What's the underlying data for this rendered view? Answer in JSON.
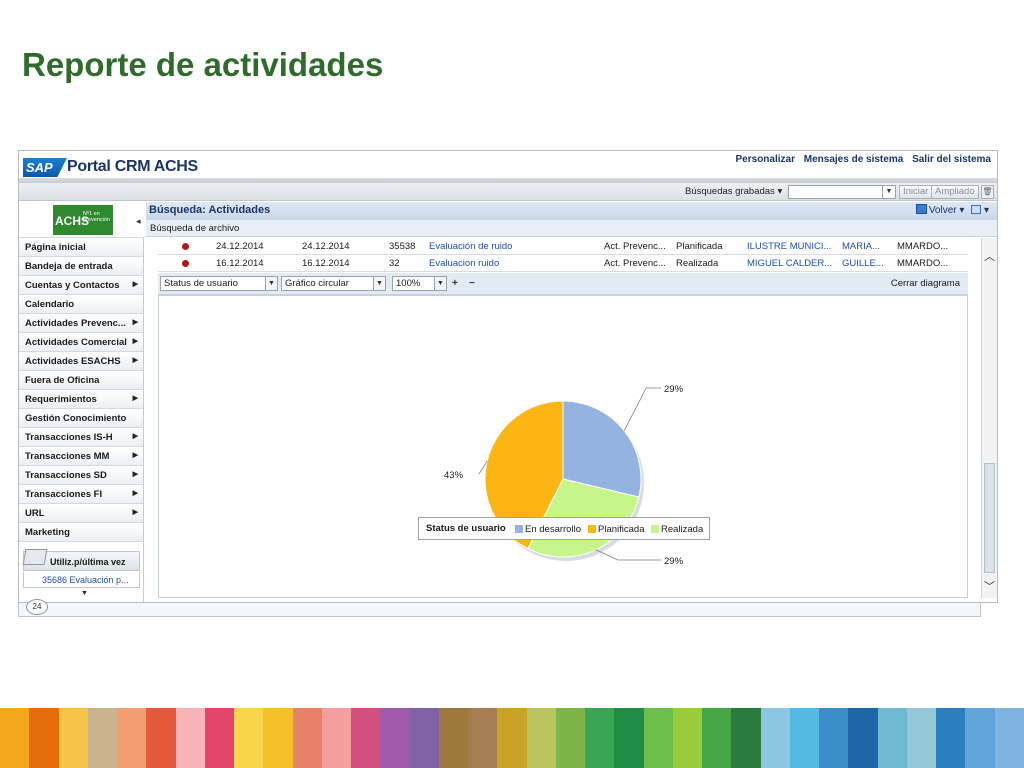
{
  "slide": {
    "title": "Reporte de actividades"
  },
  "portal": {
    "title": "Portal CRM ACHS",
    "logo_text": "SAP",
    "links": [
      "Personalizar",
      "Mensajes de sistema",
      "Salir del sistema"
    ]
  },
  "searchbar": {
    "saved_label": "Búsquedas grabadas",
    "input_value": "",
    "start_label": "Iniciar",
    "extended_label": "Ampliado"
  },
  "sidebar": {
    "logo_text": "ACHS",
    "logo_sub": "Nº1 en prevención",
    "items": [
      {
        "label": "Página inicial",
        "submenu": false
      },
      {
        "label": "Bandeja de entrada",
        "submenu": false
      },
      {
        "label": "Cuentas y Contactos",
        "submenu": true
      },
      {
        "label": "Calendario",
        "submenu": false
      },
      {
        "label": "Actividades Prevenc...",
        "submenu": true
      },
      {
        "label": "Actividades Comercial",
        "submenu": true
      },
      {
        "label": "Actividades ESACHS",
        "submenu": true
      },
      {
        "label": "Fuera de Oficina",
        "submenu": false
      },
      {
        "label": "Requerimientos",
        "submenu": true
      },
      {
        "label": "Gestión Conocimiento",
        "submenu": false
      },
      {
        "label": "Transacciones IS-H",
        "submenu": true
      },
      {
        "label": "Transacciones MM",
        "submenu": true
      },
      {
        "label": "Transacciones SD",
        "submenu": true
      },
      {
        "label": "Transacciones FI",
        "submenu": true
      },
      {
        "label": "URL",
        "submenu": true
      },
      {
        "label": "Marketing",
        "submenu": false
      }
    ],
    "recent": {
      "title": "Utiliz.p/última vez",
      "item": "35686 Evaluación p..."
    }
  },
  "main": {
    "title": "Búsqueda: Actividades",
    "back_label": "Volver",
    "subtitle": "Búsqueda de archivo",
    "rows": [
      {
        "start": "24.12.2014",
        "end": "24.12.2014",
        "id": "35538",
        "desc": "Evaluación de ruido",
        "category": "Act. Prevenc...",
        "status": "Planificada",
        "account": "ILUSTRE MUNICI...",
        "contact": "MARIA...",
        "employee": "MMARDO..."
      },
      {
        "start": "16.12.2014",
        "end": "16.12.2014",
        "id": "32",
        "desc": "Evaluacion ruido",
        "category": "Act. Prevenc...",
        "status": "Realizada",
        "account": "MIGUEL CALDER...",
        "contact": "GUILLE...",
        "employee": "MMARDO..."
      }
    ],
    "chart_toolbar": {
      "field_select": "Status de usuario",
      "chart_type_select": "Gráfico circular",
      "zoom_select": "100%",
      "plus": "+",
      "minus": "−",
      "close_label": "Cerrar diagrama"
    }
  },
  "chart_data": {
    "type": "pie",
    "title": "",
    "legend_title": "Status de usuario",
    "legend_position": "bottom",
    "slices": [
      {
        "label": "En desarrollo",
        "value": 29,
        "display": "29%",
        "color": "#95b3e0"
      },
      {
        "label": "Realizada",
        "value": 29,
        "display": "29%",
        "color": "#c6f58a"
      },
      {
        "label": "Planificada",
        "value": 43,
        "display": "43%",
        "color": "#fbb614"
      }
    ]
  },
  "footer": {
    "page_number": "24"
  },
  "colors": {
    "title_green": "#2e6b2c",
    "sap_blue": "#1b3566",
    "link_blue": "#1f4fa8"
  },
  "stripe_colors": [
    "#f3a71b",
    "#e46c0a",
    "#f7c44a",
    "#c9b38f",
    "#f29d73",
    "#e35a3b",
    "#f7b4b8",
    "#e5456a",
    "#f9d54b",
    "#f6c028",
    "#e8816a",
    "#f4a0a0",
    "#d34f7e",
    "#a05bad",
    "#8062a8",
    "#9b7a3b",
    "#a67c52",
    "#c9a227",
    "#b9c45a",
    "#7eb548",
    "#3aa655",
    "#1e8c45",
    "#6cbf4a",
    "#9bcb3b",
    "#45a648",
    "#2a7c3e",
    "#8bc6e4",
    "#56b9e3",
    "#3a8fc9",
    "#1e66a8",
    "#6eb8d2",
    "#94c8d8",
    "#2b7fbf",
    "#5fa5d9",
    "#7fb3e0"
  ]
}
